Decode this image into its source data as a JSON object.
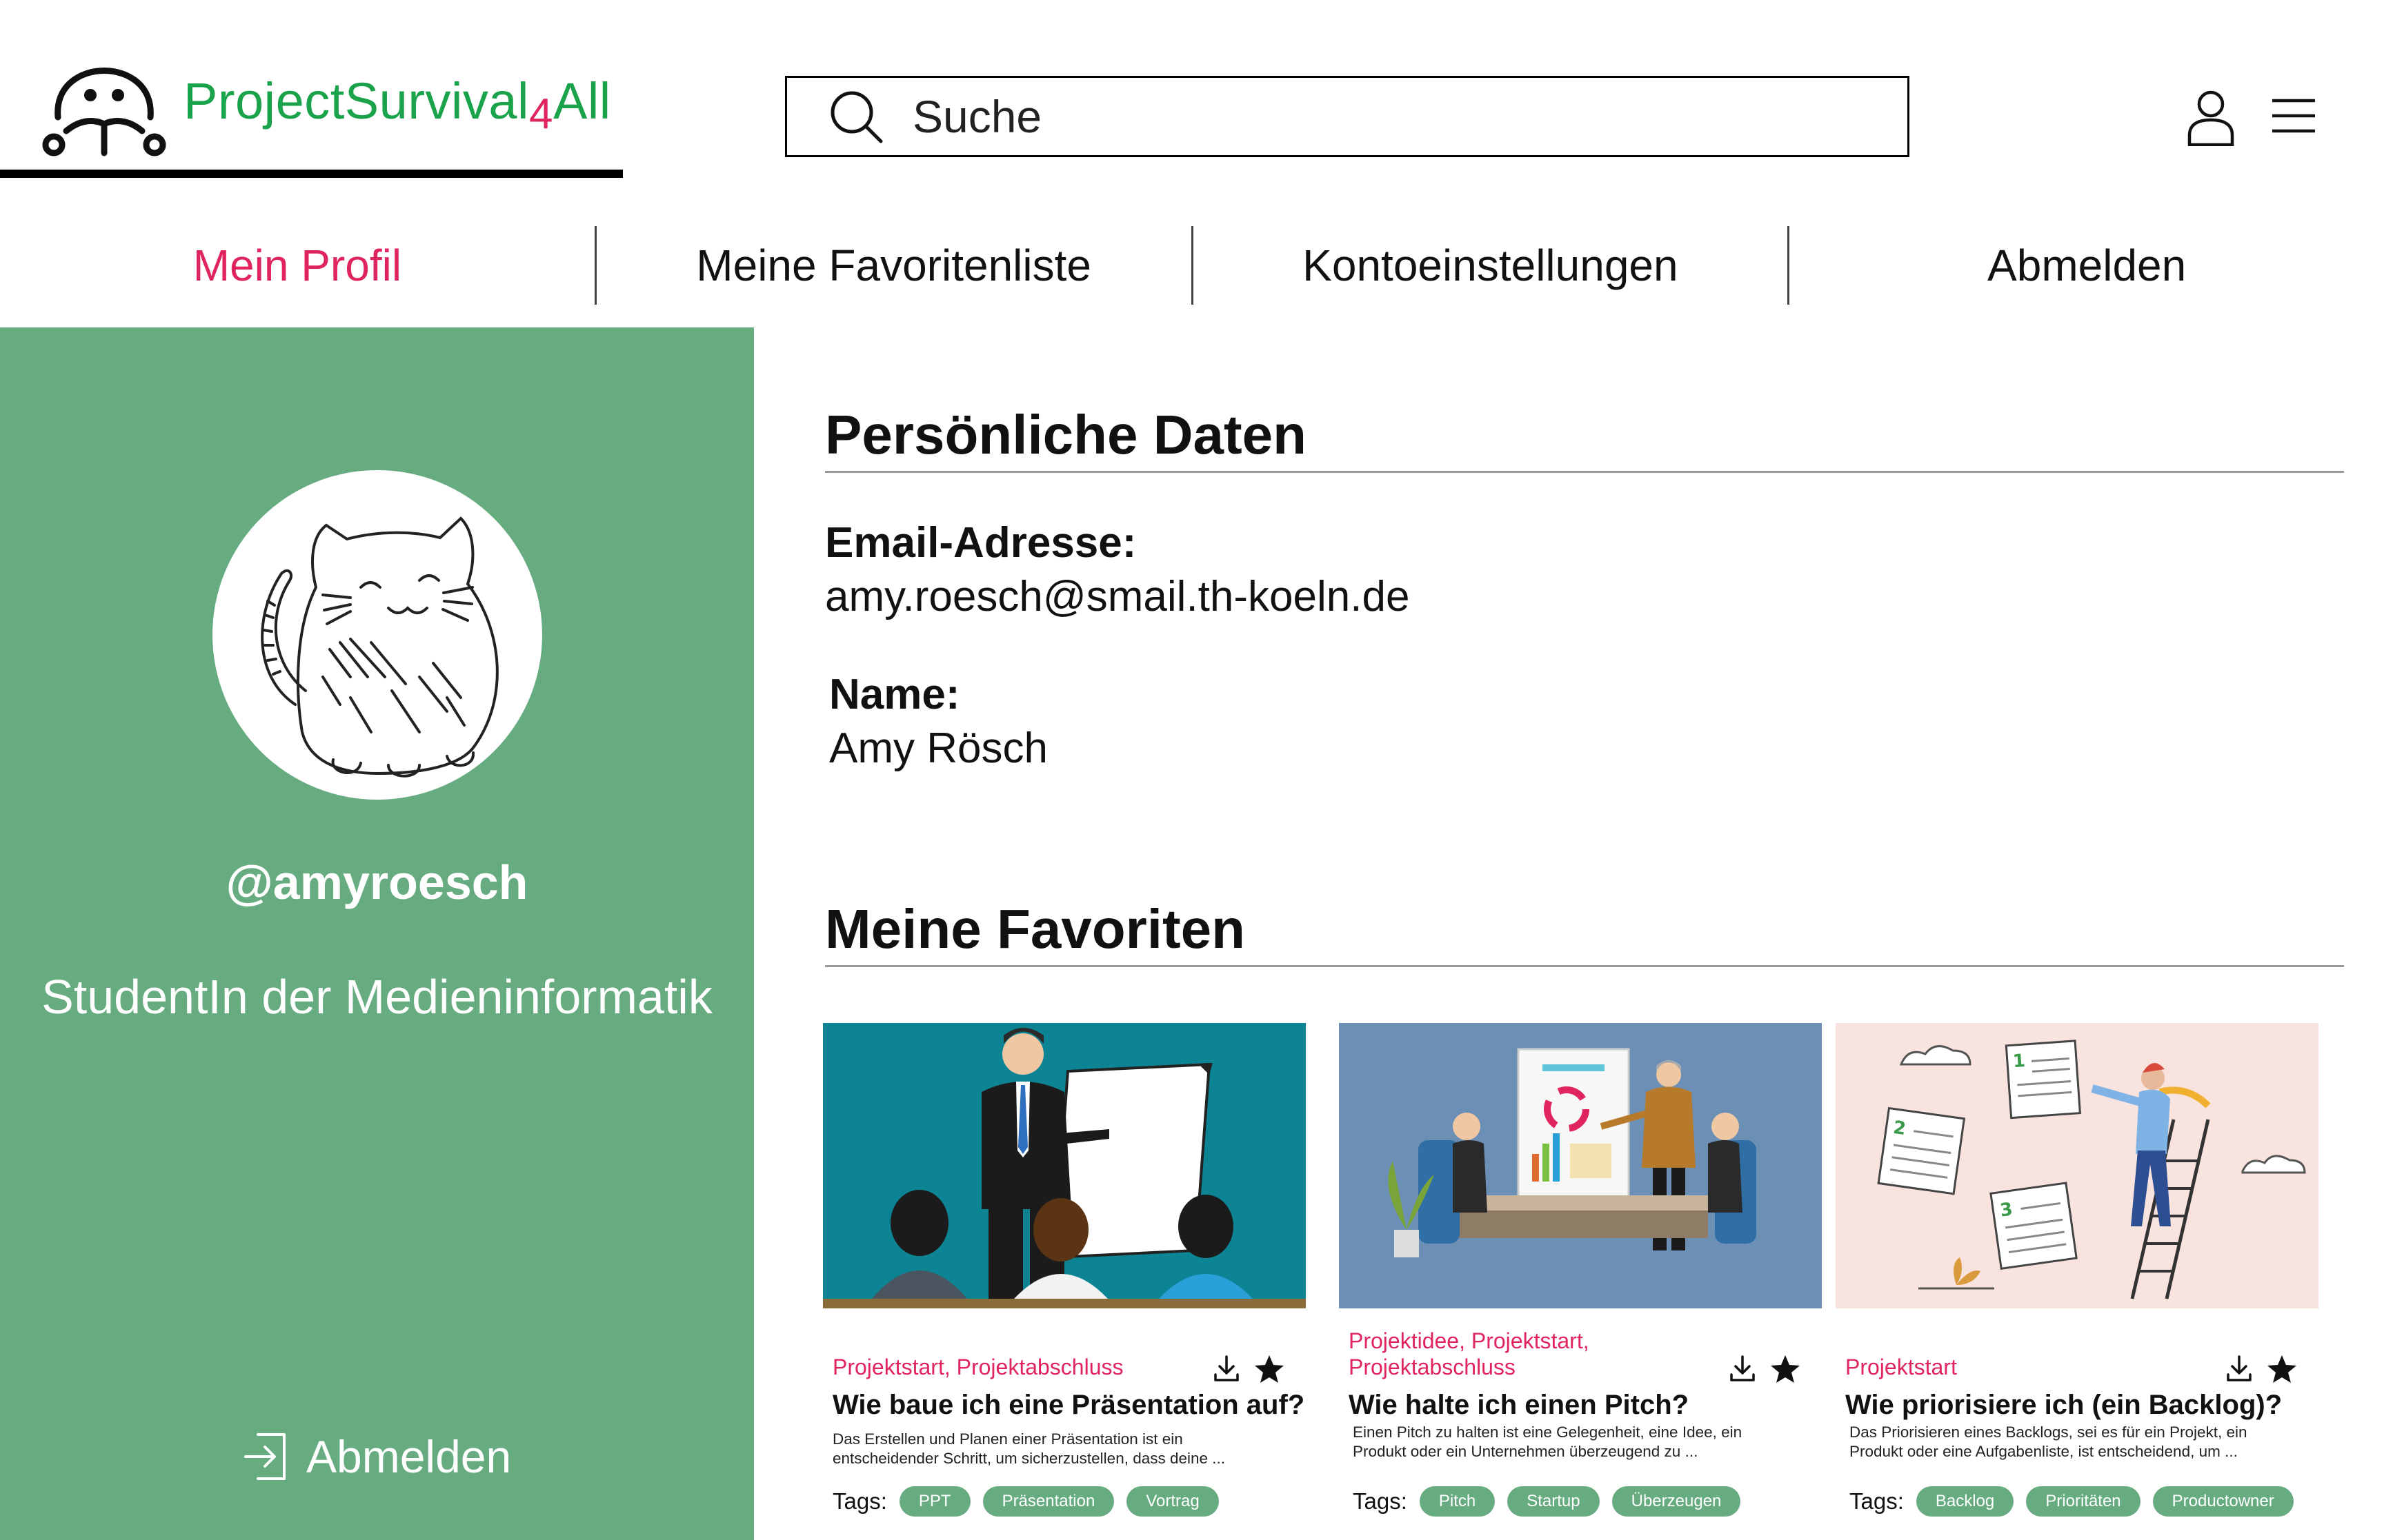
{
  "header": {
    "logo_text_1": "ProjectSurvival",
    "logo_text_2": "4",
    "logo_text_3": "All",
    "search_placeholder": "Suche"
  },
  "nav": {
    "items": [
      {
        "label": "Mein Profil",
        "active": true
      },
      {
        "label": "Meine Favoritenliste"
      },
      {
        "label": "Kontoeinstellungen"
      },
      {
        "label": "Abmelden"
      }
    ]
  },
  "sidebar": {
    "username": "@amyroesch",
    "subtitle": "StudentIn der Medieninformatik",
    "logout_label": "Abmelden"
  },
  "personal": {
    "title": "Persönliche Daten",
    "email_label": "Email-Adresse:",
    "email_value": "amy.roesch@smail.th-koeln.de",
    "name_label": "Name:",
    "name_value": "Amy Rösch"
  },
  "favorites": {
    "title": "Meine Favoriten",
    "tags_label": "Tags:",
    "cards": [
      {
        "categories": "Projektstart, Projektabschluss",
        "title": "Wie baue ich eine Präsentation auf?",
        "description": "Das Erstellen und Planen einer Präsentation ist ein entscheidender  Schritt, um sicherzustellen, dass deine ...",
        "tags": [
          "PPT",
          "Präsentation",
          "Vortrag"
        ]
      },
      {
        "categories": "Projektidee, Projektstart, Projektabschluss",
        "title": "Wie halte ich einen Pitch?",
        "description": "Einen Pitch zu halten ist eine Gelegenheit, eine Idee, ein Produkt oder ein Unternehmen überzeugend zu ...",
        "tags": [
          "Pitch",
          "Startup",
          "Überzeugen"
        ]
      },
      {
        "categories": "Projektstart",
        "title": "Wie priorisiere ich (ein Backlog)?",
        "description": "Das Priorisieren eines Backlogs, sei es für ein Projekt, ein Produkt oder eine Aufgabenliste, ist entscheidend, um ...",
        "tags": [
          "Backlog",
          "Prioritäten",
          "Productowner"
        ]
      }
    ]
  },
  "colors": {
    "brand_green": "#1aa34a",
    "accent_pink": "#e0245e",
    "sidebar_green": "#67ab80"
  }
}
